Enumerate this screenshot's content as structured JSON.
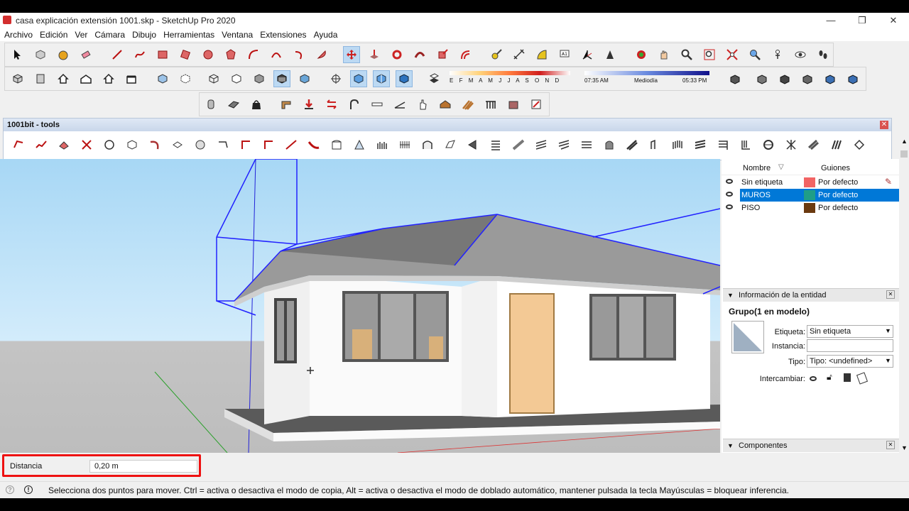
{
  "window": {
    "title": "casa explicación extensión 1001.skp - SketchUp Pro 2020",
    "minimize": "—",
    "maximize": "❐",
    "close": "✕"
  },
  "menu": [
    "Archivo",
    "Edición",
    "Ver",
    "Cámara",
    "Dibujo",
    "Herramientas",
    "Ventana",
    "Extensiones",
    "Ayuda"
  ],
  "shadows": {
    "months": [
      "E",
      "F",
      "M",
      "A",
      "M",
      "J",
      "J",
      "A",
      "S",
      "O",
      "N",
      "D"
    ],
    "time_start": "07:35 AM",
    "time_mid": "Mediodía",
    "time_end": "05:33 PM"
  },
  "panel_1001": {
    "title": "1001bit - tools",
    "close": "✕"
  },
  "tags": {
    "col_name": "Nombre",
    "col_dashes": "Guiones",
    "rows": [
      {
        "name": "Sin etiqueta",
        "dash": "Por defecto",
        "color": "#f26464"
      },
      {
        "name": "MUROS",
        "dash": "Por defecto",
        "color": "#1f9e87"
      },
      {
        "name": "PISO",
        "dash": "Por defecto",
        "color": "#6b3a10"
      }
    ]
  },
  "entity_info": {
    "header": "Información de la entidad",
    "title": "Grupo(1 en modelo)",
    "tag_label": "Etiqueta:",
    "tag_value": "Sin etiqueta",
    "instance_label": "Instancia:",
    "instance_value": "",
    "type_label": "Tipo:",
    "type_value": "Tipo: <undefined>",
    "toggles_label": "Intercambiar:"
  },
  "components": {
    "header": "Componentes"
  },
  "vcb": {
    "label": "Distancia",
    "value": "0,20 m"
  },
  "status": {
    "message": "Selecciona dos puntos para mover. Ctrl = activa o desactiva el modo de copia, Alt = activa o desactiva el modo de doblado automático, mantener pulsada la tecla Mayúsculas = bloquear inferencia."
  },
  "colors": {
    "selection": "#0078d7",
    "highlight_outline": "#e11111"
  }
}
